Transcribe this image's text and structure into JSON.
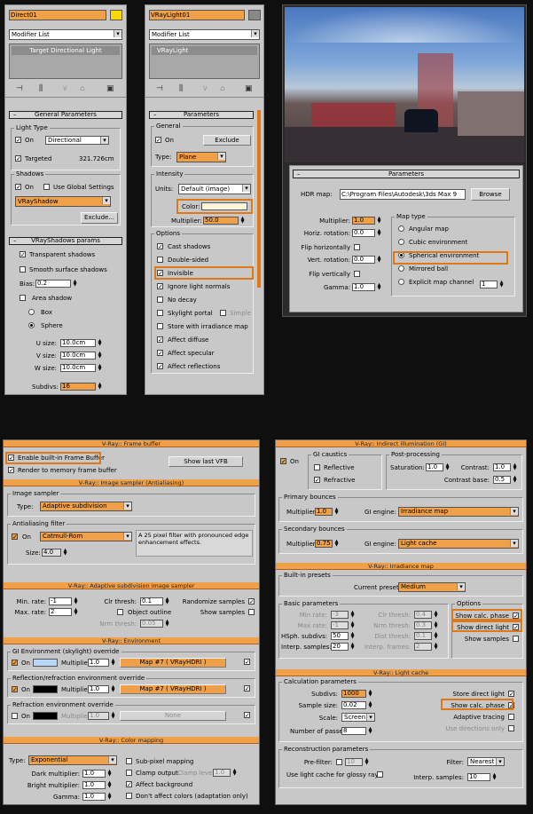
{
  "top": {
    "left": {
      "name": "Direct01",
      "modifier_list": "Modifier List",
      "stack_item": "Target Directional Light",
      "rollout_general": "General Parameters",
      "light_type_label": "Light Type",
      "on_label": "On",
      "type_value": "Directional",
      "targeted_label": "Targeted",
      "targeted_value": "321.726cm",
      "shadows_label": "Shadows",
      "use_global_label": "Use Global Settings",
      "shadow_type": "VRayShadow",
      "exclude_label": "Exclude...",
      "rollout_vrayshadows": "VRayShadows params",
      "transparent_label": "Transparent shadows",
      "smooth_label": "Smooth surface shadows",
      "bias_label": "Bias:",
      "bias_value": "0.2",
      "area_label": "Area shadow",
      "box_label": "Box",
      "sphere_label": "Sphere",
      "usize_label": "U size:",
      "usize_value": "10.0cm",
      "vsize_label": "V size:",
      "vsize_value": "10.0cm",
      "wsize_label": "W size:",
      "wsize_value": "10.0cm",
      "subdivs_label": "Subdivs:",
      "subdivs_value": "16"
    },
    "mid": {
      "name": "VRayLight01",
      "modifier_list": "Modifier List",
      "stack_item": "VRayLight",
      "rollout": "Parameters",
      "general_label": "General",
      "on_label": "On",
      "exclude_label": "Exclude",
      "type_label": "Type:",
      "type_value": "Plane",
      "intensity_label": "Intensity",
      "units_label": "Units:",
      "units_value": "Default (image)",
      "color_label": "Color:",
      "multiplier_label": "Multiplier:",
      "multiplier_value": "50.0",
      "options_label": "Options",
      "options": [
        "Cast shadows",
        "Double-sided",
        "Invisible",
        "Ignore light normals",
        "No decay",
        "Skylight portal",
        "Store with irradiance map",
        "Affect diffuse",
        "Affect specular",
        "Affect reflections"
      ],
      "simple_label": "Simple"
    },
    "hdr": {
      "rollout": "Parameters",
      "hdr_map_label": "HDR map:",
      "hdr_map_value": "C:\\Program Files\\Autodesk\\3ds Max 9",
      "browse_label": "Browse",
      "multiplier_label": "Multiplier:",
      "multiplier_value": "1.0",
      "horiz_label": "Horiz. rotation:",
      "horiz_value": "0.0",
      "flip_h_label": "Flip horizontally",
      "vert_label": "Vert. rotation:",
      "vert_value": "0.0",
      "flip_v_label": "Flip vertically",
      "gamma_label": "Gamma:",
      "gamma_value": "1.0",
      "maptype_label": "Map type",
      "maptypes": [
        "Angular map",
        "Cubic environment",
        "Spherical environment",
        "Mirrored ball",
        "Explicit map channel"
      ],
      "channel_value": "1"
    }
  },
  "bottom_left": {
    "fb_bar": "V-Ray:: Frame buffer",
    "enable_fb": "Enable built-in Frame Buffer",
    "show_last": "Show last VFB",
    "render_mem": "Render to memory frame buffer",
    "sampler_bar": "V-Ray:: Image sampler (Antialiasing)",
    "sampler_group": "Image sampler",
    "type_label": "Type:",
    "type_value": "Adaptive subdivision",
    "aa_group": "Antialiasing filter",
    "on_label": "On",
    "filter_value": "Catmull-Rom",
    "filter_desc": "A 25 pixel filter with pronounced edge enhancement effects.",
    "size_label": "Size:",
    "size_value": "4.0",
    "adapt_bar": "V-Ray:: Adaptive subdivision image sampler",
    "min_rate_label": "Min. rate:",
    "min_rate_value": "-1",
    "max_rate_label": "Max. rate:",
    "max_rate_value": "2",
    "clr_thresh_label": "Clr thresh:",
    "clr_thresh_value": "0.1",
    "obj_outline": "Object outline",
    "nrm_thresh_label": "Nrm thresh:",
    "nrm_thresh_value": "0.05",
    "randomize": "Randomize samples",
    "show_samples": "Show samples",
    "env_bar": "V-Ray:: Environment",
    "gi_env_group": "GI Environment (skylight) override",
    "multiplier_label": "Multiplier:",
    "gi_mult": "1.0",
    "map_label": "Map #7  ( VRayHDRI )",
    "refl_group": "Reflection/refraction environment override",
    "refl_mult": "1.0",
    "refr_group": "Refraction environment override",
    "refr_mult": "1.0",
    "none_label": "None",
    "color_bar": "V-Ray:: Color mapping",
    "cm_type_label": "Type:",
    "cm_type_value": "Exponential",
    "dark_label": "Dark multiplier:",
    "dark_value": "1.0",
    "bright_label": "Bright multiplier:",
    "bright_value": "1.0",
    "gamma_label": "Gamma:",
    "gamma_value": "1.0",
    "subpixel": "Sub-pixel mapping",
    "clamp": "Clamp output",
    "clamp_level_label": "Clamp level:",
    "clamp_level": "1.0",
    "affect_bg": "Affect background",
    "dont_affect": "Don't affect colors (adaptation only)"
  },
  "bottom_right": {
    "gi_bar": "V-Ray:: Indirect illumination (GI)",
    "on_label": "On",
    "caustics_group": "GI caustics",
    "reflective": "Reflective",
    "refractive": "Refractive",
    "post_group": "Post-processing",
    "saturation_label": "Saturation:",
    "saturation_value": "1.0",
    "contrast_label": "Contrast:",
    "contrast_value": "1.0",
    "contrast_base_label": "Contrast base:",
    "contrast_base_value": "0.5",
    "primary_group": "Primary bounces",
    "multiplier_label": "Multiplier:",
    "primary_mult": "1.0",
    "gi_engine_label": "GI engine:",
    "primary_engine": "Irradiance map",
    "secondary_group": "Secondary bounces",
    "secondary_mult": "0.75",
    "secondary_engine": "Light cache",
    "irr_bar": "V-Ray:: Irradiance map",
    "presets_group": "Built-in presets",
    "current_preset_label": "Current preset:",
    "current_preset": "Medium",
    "basic_group": "Basic parameters",
    "min_rate_label": "Min rate:",
    "min_rate_value": "-3",
    "max_rate_label": "Max rate:",
    "max_rate_value": "-1",
    "hsph_label": "HSph. subdivs:",
    "hsph_value": "50",
    "interp_label": "Interp. samples:",
    "interp_value": "20",
    "clr_thresh_label": "Clr thresh:",
    "clr_thresh_value": "0.4",
    "nrm_thresh_label": "Nrm thresh:",
    "nrm_thresh_value": "0.3",
    "dist_thresh_label": "Dist thresh:",
    "dist_thresh_value": "0.1",
    "interp_frames_label": "Interp. frames:",
    "interp_frames_value": "2",
    "options_group": "Options",
    "show_calc": "Show calc. phase",
    "show_direct": "Show direct light",
    "show_samples": "Show samples",
    "lc_bar": "V-Ray:: Light cache",
    "calc_group": "Calculation parameters",
    "subdivs_label": "Subdivs:",
    "subdivs_value": "1000",
    "sample_size_label": "Sample size:",
    "sample_size_value": "0.02",
    "scale_label": "Scale:",
    "scale_value": "Screen",
    "passes_label": "Number of passes:",
    "passes_value": "8",
    "store_direct": "Store direct light",
    "lc_show_calc": "Show calc. phase",
    "adaptive": "Adaptive tracing",
    "use_dirs": "Use directions only",
    "recon_group": "Reconstruction parameters",
    "prefilter_label": "Pre-filter:",
    "prefilter_value": "10",
    "use_lc_glossy": "Use light cache for glossy rays",
    "filter_label": "Filter:",
    "filter_value": "Nearest",
    "interp_samples_label": "Interp. samples:",
    "interp_samples_value": "10"
  }
}
